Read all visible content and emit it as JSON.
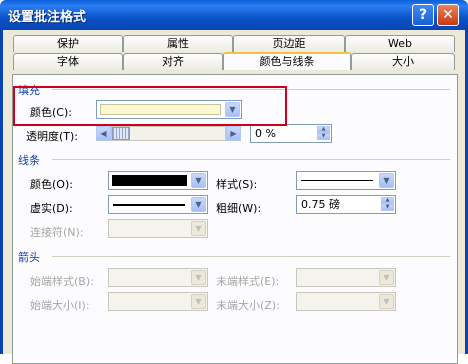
{
  "title": "设置批注格式",
  "tabs_row1": [
    "保护",
    "属性",
    "页边距",
    "Web"
  ],
  "tabs_row2": [
    "字体",
    "对齐",
    "颜色与线条",
    "大小"
  ],
  "active_tab": "颜色与线条",
  "fill": {
    "section": "填充",
    "color_label": "颜色(C):",
    "color_value": "#fdf8cf",
    "transparency_label": "透明度(T):",
    "transparency_value": "0 %",
    "transparency_percent": 0
  },
  "line": {
    "section": "线条",
    "color_label": "颜色(O):",
    "color_value": "#000000",
    "style_label": "样式(S):",
    "dashed_label": "虚实(D):",
    "weight_label": "粗细(W):",
    "weight_value": "0.75 磅",
    "connector_label": "连接符(N):"
  },
  "arrows": {
    "section": "箭头",
    "begin_style_label": "始端样式(B):",
    "end_style_label": "末端样式(E):",
    "begin_size_label": "始端大小(I):",
    "end_size_label": "末端大小(Z):"
  },
  "icons": {
    "help": "?",
    "close": "✕",
    "dropdown": "▼",
    "left": "◀",
    "right": "▶",
    "up": "▲",
    "down": "▼"
  }
}
